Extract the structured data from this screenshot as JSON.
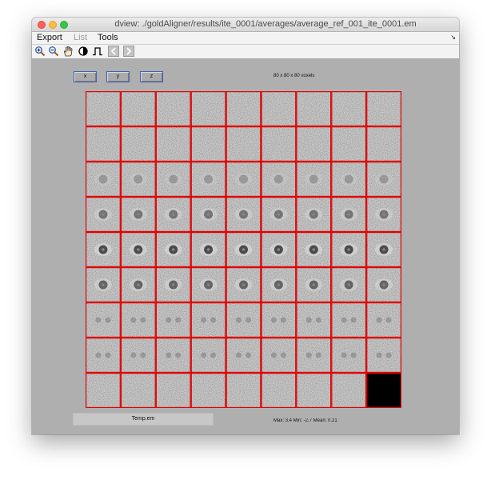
{
  "window": {
    "title": "dview: ./goldAligner/results/ite_0001/averages/average_ref_001_ite_0001.em"
  },
  "menu": {
    "items": [
      {
        "label": "Export",
        "enabled": true
      },
      {
        "label": "List",
        "enabled": false
      },
      {
        "label": "Tools",
        "enabled": true
      }
    ],
    "corner_icon": "resize-corner-icon"
  },
  "toolbar": {
    "tools": [
      {
        "name": "zoom-in-icon"
      },
      {
        "name": "zoom-out-icon"
      },
      {
        "name": "pan-hand-icon"
      },
      {
        "name": "contrast-icon"
      },
      {
        "name": "threshold-icon"
      },
      {
        "name": "previous-icon"
      },
      {
        "name": "next-icon"
      }
    ]
  },
  "view": {
    "axis_buttons": [
      "x",
      "y",
      "z"
    ],
    "dimensions_label": "80 x 80 x 80 voxels",
    "grid": {
      "rows": 9,
      "cols": 9,
      "slice_count": 80,
      "border_color": "#e00000",
      "empty_cell_color": "#000000"
    },
    "filename": "Temp.em",
    "stats_text": "Max:    3.4  Min:   -2.7  Mean:   0.21"
  }
}
